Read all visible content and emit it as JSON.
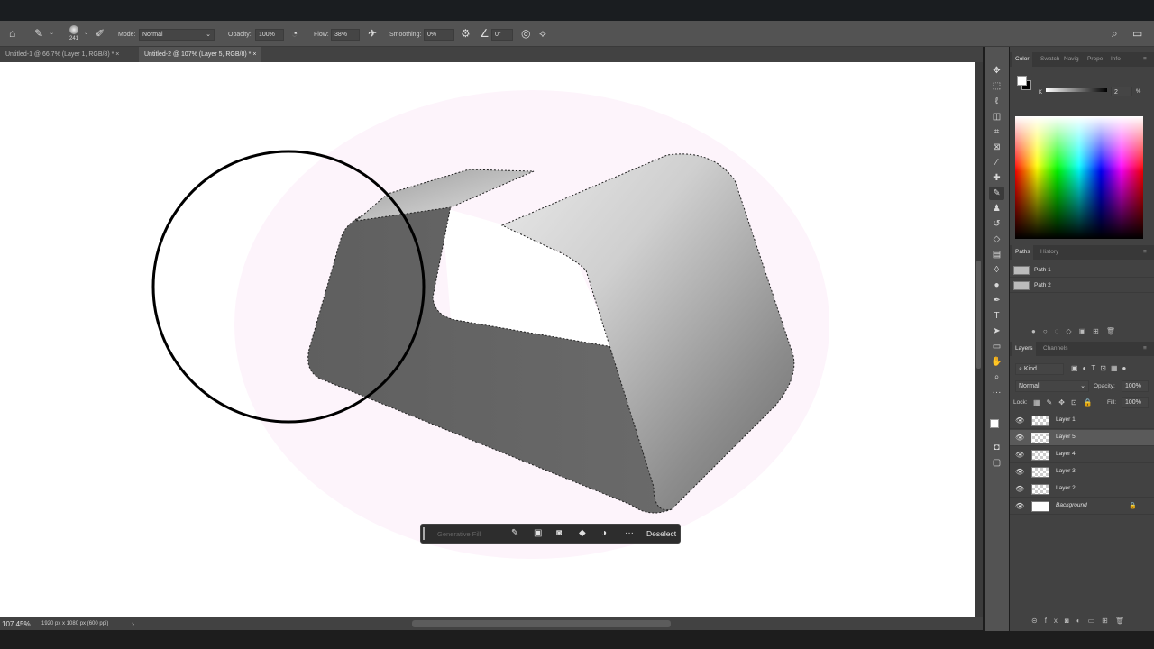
{
  "options_bar": {
    "brush_size": "241",
    "mode_label": "Mode:",
    "mode_value": "Normal",
    "opacity_label": "Opacity:",
    "opacity_value": "100%",
    "flow_label": "Flow:",
    "flow_value": "38%",
    "smoothing_label": "Smoothing:",
    "smoothing_value": "0%",
    "angle_value": "0°"
  },
  "tabs": [
    {
      "label": "Untitled-1 @ 66.7% (Layer 1, RGB/8) *",
      "close": "×"
    },
    {
      "label": "Untitled-2 @ 107% (Layer 5, RGB/8) *",
      "close": "×"
    }
  ],
  "status": {
    "zoom": "107.45%",
    "doc_info": "1920 px x 1080 px (600 ppi)",
    "arrow": "›"
  },
  "context_bar": {
    "generative_fill": "Generative Fill",
    "deselect": "Deselect",
    "more": "···"
  },
  "color_panel": {
    "tabs": [
      "Color",
      "Swatch",
      "Navig",
      "Prope",
      "Info"
    ],
    "channel": "K",
    "value": "2",
    "unit": "%"
  },
  "paths_panel": {
    "tabs": [
      "Paths",
      "History"
    ],
    "items": [
      "Path 1",
      "Path 2"
    ]
  },
  "layers_panel": {
    "tabs": [
      "Layers",
      "Channels"
    ],
    "kind": "Kind",
    "blend_mode": "Normal",
    "opacity_label": "Opacity:",
    "opacity_value": "100%",
    "lock_label": "Lock:",
    "fill_label": "Fill:",
    "fill_value": "100%",
    "layers": [
      "Layer 1",
      "Layer 5",
      "Layer 4",
      "Layer 3",
      "Layer 2",
      "Background"
    ]
  }
}
